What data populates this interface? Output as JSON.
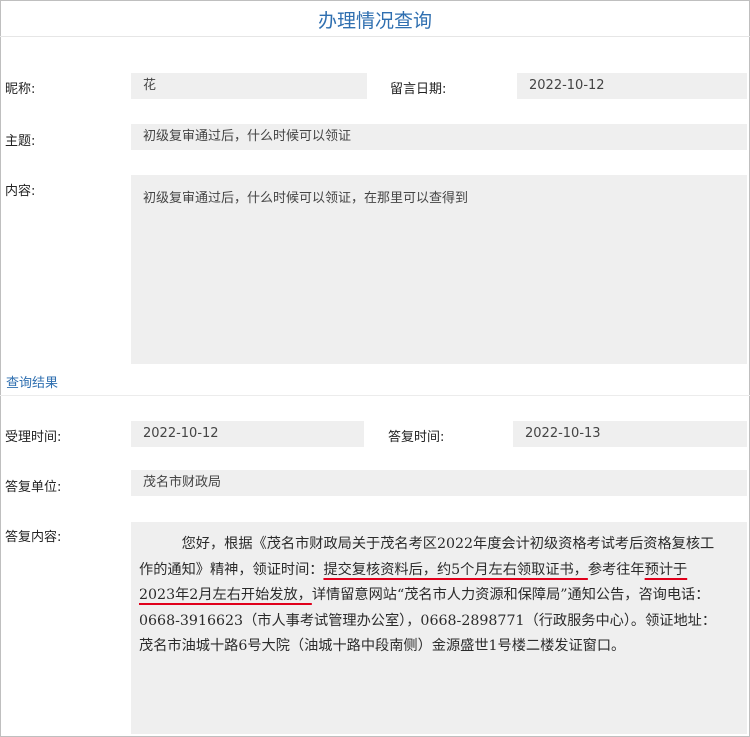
{
  "page": {
    "title": "办理情况查询"
  },
  "message": {
    "nickname_label": "昵称:",
    "nickname_value": "花",
    "date_label": "留言日期:",
    "date_value": "2022-10-12",
    "subject_label": "主题:",
    "subject_value": "初级复审通过后，什么时候可以领证",
    "content_label": "内容:",
    "content_value": "初级复审通过后，什么时候可以领证，在那里可以查得到"
  },
  "result": {
    "section_link": "查询结果",
    "accept_time_label": "受理时间:",
    "accept_time_value": "2022-10-12",
    "reply_time_label": "答复时间:",
    "reply_time_value": "2022-10-13",
    "reply_unit_label": "答复单位:",
    "reply_unit_value": "茂名市财政局",
    "reply_content_label": "答复内容:",
    "reply_content": {
      "part1": "　　　您好，根据《茂名市财政局关于茂名考区2022年度会计初级资格考试考后资格复核工作的通知》精神，领证时间：",
      "highlight1": "提交复核资料后，约5个月左右领取证书，",
      "part2": "参考往年",
      "highlight2": "预计于2023年2月左右开始发放，",
      "part3": "详情留意网站“茂名市人力资源和保障局”通知公告，咨询电话：0668-3916623（市人事考试管理办公室），0668-2898771（行政服务中心）。领证地址：茂名市油城十路6号大院（油城十路中段南侧）金源盛世1号楼二楼发证窗口。"
    }
  },
  "colors": {
    "accent": "#2f6fb0",
    "field_bg": "#efefef",
    "underline": "#e0001b"
  }
}
